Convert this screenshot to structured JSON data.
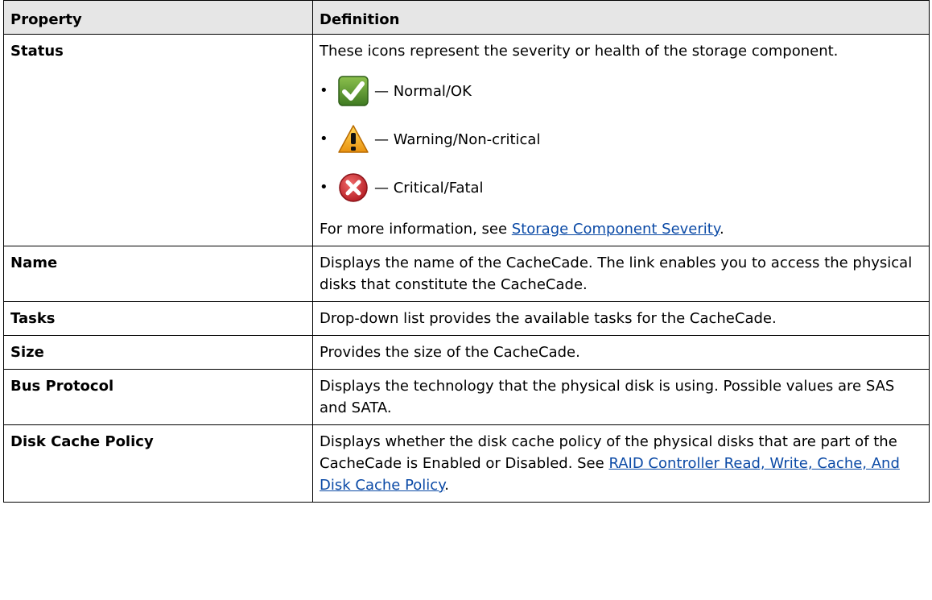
{
  "table": {
    "header": {
      "property": "Property",
      "definition": "Definition"
    },
    "status": {
      "name": "Status",
      "intro": "These icons represent the severity or health of the storage component.",
      "severities": [
        {
          "icon": "check-ok-icon",
          "label": "— Normal/OK",
          "color": "#5a8f2c"
        },
        {
          "icon": "warning-icon",
          "label": "— Warning/Non-critical",
          "color": "#f2a51c"
        },
        {
          "icon": "critical-icon",
          "label": "— Critical/Fatal",
          "color": "#c8222a"
        }
      ],
      "more_prefix": "For more information, see ",
      "more_link": "Storage Component Severity",
      "more_suffix": "."
    },
    "rows": [
      {
        "name": "Name",
        "definition": "Displays the name of the CacheCade. The link enables you to access the physical disks that constitute the CacheCade."
      },
      {
        "name": "Tasks",
        "definition": "Drop-down list provides the available tasks for the CacheCade."
      },
      {
        "name": "Size",
        "definition": "Provides the size of the CacheCade."
      },
      {
        "name": "Bus Protocol",
        "definition": "Displays the technology that the physical disk is using. Possible values are SAS and SATA."
      }
    ],
    "disk_cache": {
      "name": "Disk Cache Policy",
      "text_prefix": "Displays whether the disk cache policy of the physical disks that are part of the CacheCade is Enabled or Disabled. See ",
      "link": "RAID Controller Read, Write, Cache, And Disk Cache Policy",
      "text_suffix": "."
    }
  }
}
